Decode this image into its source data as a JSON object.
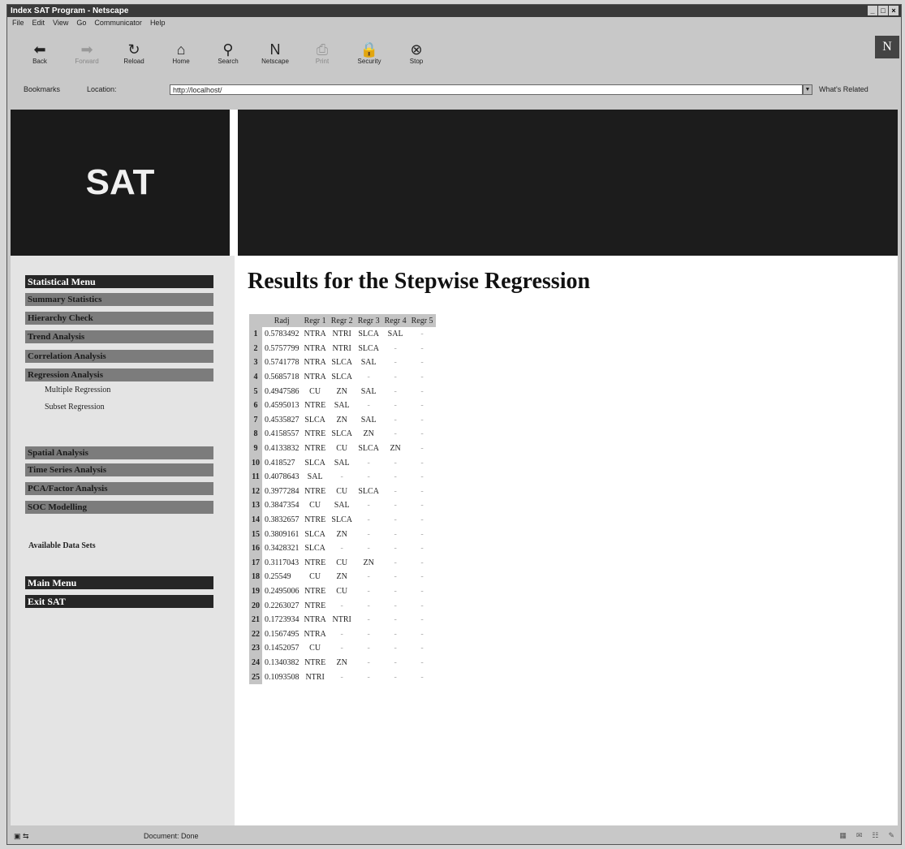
{
  "window": {
    "title": "Index SAT Program - Netscape"
  },
  "menu": [
    "File",
    "Edit",
    "View",
    "Go",
    "Communicator",
    "Help"
  ],
  "toolbar": [
    {
      "label": "Back",
      "icon": "back-arrow-icon",
      "glyph": "⬅"
    },
    {
      "label": "Forward",
      "icon": "forward-arrow-icon",
      "glyph": "➡"
    },
    {
      "label": "Reload",
      "icon": "reload-icon",
      "glyph": "↻"
    },
    {
      "label": "Home",
      "icon": "home-icon",
      "glyph": "⌂"
    },
    {
      "label": "Search",
      "icon": "search-icon",
      "glyph": "⚲"
    },
    {
      "label": "Netscape",
      "icon": "netscape-icon",
      "glyph": "N"
    },
    {
      "label": "Print",
      "icon": "print-icon",
      "glyph": "⎙"
    },
    {
      "label": "Security",
      "icon": "security-icon",
      "glyph": "🔒"
    },
    {
      "label": "Stop",
      "icon": "stop-icon",
      "glyph": "⊗"
    }
  ],
  "location": {
    "bookmarks": "Bookmarks",
    "label": "Location:",
    "url": "http://localhost/",
    "related": "What's Related"
  },
  "logo": "SAT",
  "sidebar": {
    "statistical_menu": "Statistical Menu",
    "items": [
      "Summary Statistics",
      "Hierarchy Check",
      "Trend Analysis",
      "Correlation Analysis",
      "Regression Analysis"
    ],
    "sub": [
      "Multiple Regression",
      "Subset Regression"
    ],
    "items2": [
      "Spatial Analysis",
      "Time Series Analysis",
      "PCA/Factor Analysis",
      "SOC Modelling"
    ],
    "available": "Available Data Sets",
    "main_menu": "Main Menu",
    "exit": "Exit SAT"
  },
  "page": {
    "title": "Results for the Stepwise Regression"
  },
  "table": {
    "headers": [
      "",
      "Radj",
      "Regr 1",
      "Regr 2",
      "Regr 3",
      "Regr 4",
      "Regr 5"
    ],
    "rows": [
      [
        "1",
        "0.5783492",
        "NTRA",
        "NTRI",
        "SLCA",
        "SAL",
        "-"
      ],
      [
        "2",
        "0.5757799",
        "NTRA",
        "NTRI",
        "SLCA",
        "-",
        "-"
      ],
      [
        "3",
        "0.5741778",
        "NTRA",
        "SLCA",
        "SAL",
        "-",
        "-"
      ],
      [
        "4",
        "0.5685718",
        "NTRA",
        "SLCA",
        "-",
        "-",
        "-"
      ],
      [
        "5",
        "0.4947586",
        "CU",
        "ZN",
        "SAL",
        "-",
        "-"
      ],
      [
        "6",
        "0.4595013",
        "NTRE",
        "SAL",
        "-",
        "-",
        "-"
      ],
      [
        "7",
        "0.4535827",
        "SLCA",
        "ZN",
        "SAL",
        "-",
        "-"
      ],
      [
        "8",
        "0.4158557",
        "NTRE",
        "SLCA",
        "ZN",
        "-",
        "-"
      ],
      [
        "9",
        "0.4133832",
        "NTRE",
        "CU",
        "SLCA",
        "ZN",
        "-"
      ],
      [
        "10",
        "0.418527",
        "SLCA",
        "SAL",
        "-",
        "-",
        "-"
      ],
      [
        "11",
        "0.4078643",
        "SAL",
        "-",
        "-",
        "-",
        "-"
      ],
      [
        "12",
        "0.3977284",
        "NTRE",
        "CU",
        "SLCA",
        "-",
        "-"
      ],
      [
        "13",
        "0.3847354",
        "CU",
        "SAL",
        "-",
        "-",
        "-"
      ],
      [
        "14",
        "0.3832657",
        "NTRE",
        "SLCA",
        "-",
        "-",
        "-"
      ],
      [
        "15",
        "0.3809161",
        "SLCA",
        "ZN",
        "-",
        "-",
        "-"
      ],
      [
        "16",
        "0.3428321",
        "SLCA",
        "-",
        "-",
        "-",
        "-"
      ],
      [
        "17",
        "0.3117043",
        "NTRE",
        "CU",
        "ZN",
        "-",
        "-"
      ],
      [
        "18",
        "0.25549",
        "CU",
        "ZN",
        "-",
        "-",
        "-"
      ],
      [
        "19",
        "0.2495006",
        "NTRE",
        "CU",
        "-",
        "-",
        "-"
      ],
      [
        "20",
        "0.2263027",
        "NTRE",
        "-",
        "-",
        "-",
        "-"
      ],
      [
        "21",
        "0.1723934",
        "NTRA",
        "NTRI",
        "-",
        "-",
        "-"
      ],
      [
        "22",
        "0.1567495",
        "NTRA",
        "-",
        "-",
        "-",
        "-"
      ],
      [
        "23",
        "0.1452057",
        "CU",
        "-",
        "-",
        "-",
        "-"
      ],
      [
        "24",
        "0.1340382",
        "NTRE",
        "ZN",
        "-",
        "-",
        "-"
      ],
      [
        "25",
        "0.1093508",
        "NTRI",
        "-",
        "-",
        "-",
        "-"
      ]
    ]
  },
  "status": {
    "text": "Document: Done"
  }
}
